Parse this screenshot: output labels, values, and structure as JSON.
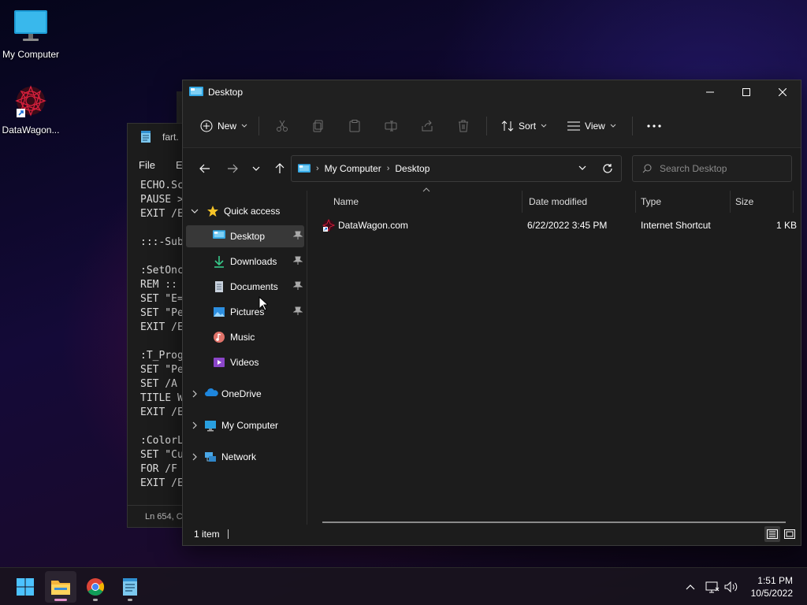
{
  "desktop": {
    "icons": [
      {
        "label": "My Computer",
        "icon": "monitor-icon"
      },
      {
        "label": "DataWagon...",
        "icon": "datawagon-shortcut-icon"
      }
    ]
  },
  "notepad": {
    "title": "fart.",
    "menu": [
      "File",
      "E"
    ],
    "lines": [
      "ECHO.Sc",
      "PAUSE >",
      "EXIT /E",
      "",
      ":::-Sub",
      "",
      ":SetOnc",
      "REM :: ",
      "SET \"E=",
      "SET \"Pe",
      "EXIT /E",
      "",
      ":T_Prog",
      "SET \"Pe",
      "SET /A ",
      "TITLE W",
      "EXIT /E",
      "",
      ":ColorL",
      "SET \"Cu",
      "FOR /F ",
      "EXIT /E"
    ],
    "status": "Ln 654, C"
  },
  "explorer": {
    "title": "Desktop",
    "toolbar": {
      "new_label": "New",
      "sort_label": "Sort",
      "view_label": "View"
    },
    "address": {
      "crumbs": [
        "My Computer",
        "Desktop"
      ]
    },
    "search": {
      "placeholder": "Search Desktop"
    },
    "nav": {
      "quick_access": "Quick access",
      "pinned": [
        {
          "label": "Desktop",
          "icon": "desktop-folder-icon",
          "pinned": true,
          "selected": true
        },
        {
          "label": "Downloads",
          "icon": "downloads-icon",
          "pinned": true
        },
        {
          "label": "Documents",
          "icon": "documents-icon",
          "pinned": true
        },
        {
          "label": "Pictures",
          "icon": "pictures-icon",
          "pinned": true
        },
        {
          "label": "Music",
          "icon": "music-icon",
          "pinned": false
        },
        {
          "label": "Videos",
          "icon": "videos-icon",
          "pinned": false
        }
      ],
      "roots": [
        {
          "label": "OneDrive",
          "icon": "onedrive-cloud-icon"
        },
        {
          "label": "My Computer",
          "icon": "monitor-icon"
        },
        {
          "label": "Network",
          "icon": "network-icon"
        }
      ]
    },
    "columns": [
      "Name",
      "Date modified",
      "Type",
      "Size"
    ],
    "files": [
      {
        "name": "DataWagon.com",
        "date": "6/22/2022 3:45 PM",
        "type": "Internet Shortcut",
        "size": "1 KB"
      }
    ],
    "status": "1 item"
  },
  "taskbar": {
    "apps": [
      "start-icon",
      "file-explorer-icon",
      "chrome-icon",
      "notepad-icon"
    ],
    "time": "1:51 PM",
    "date": "10/5/2022"
  },
  "colors": {
    "accent": "#60cdff",
    "window_bg": "#1c1c1c",
    "selection": "#383838"
  }
}
